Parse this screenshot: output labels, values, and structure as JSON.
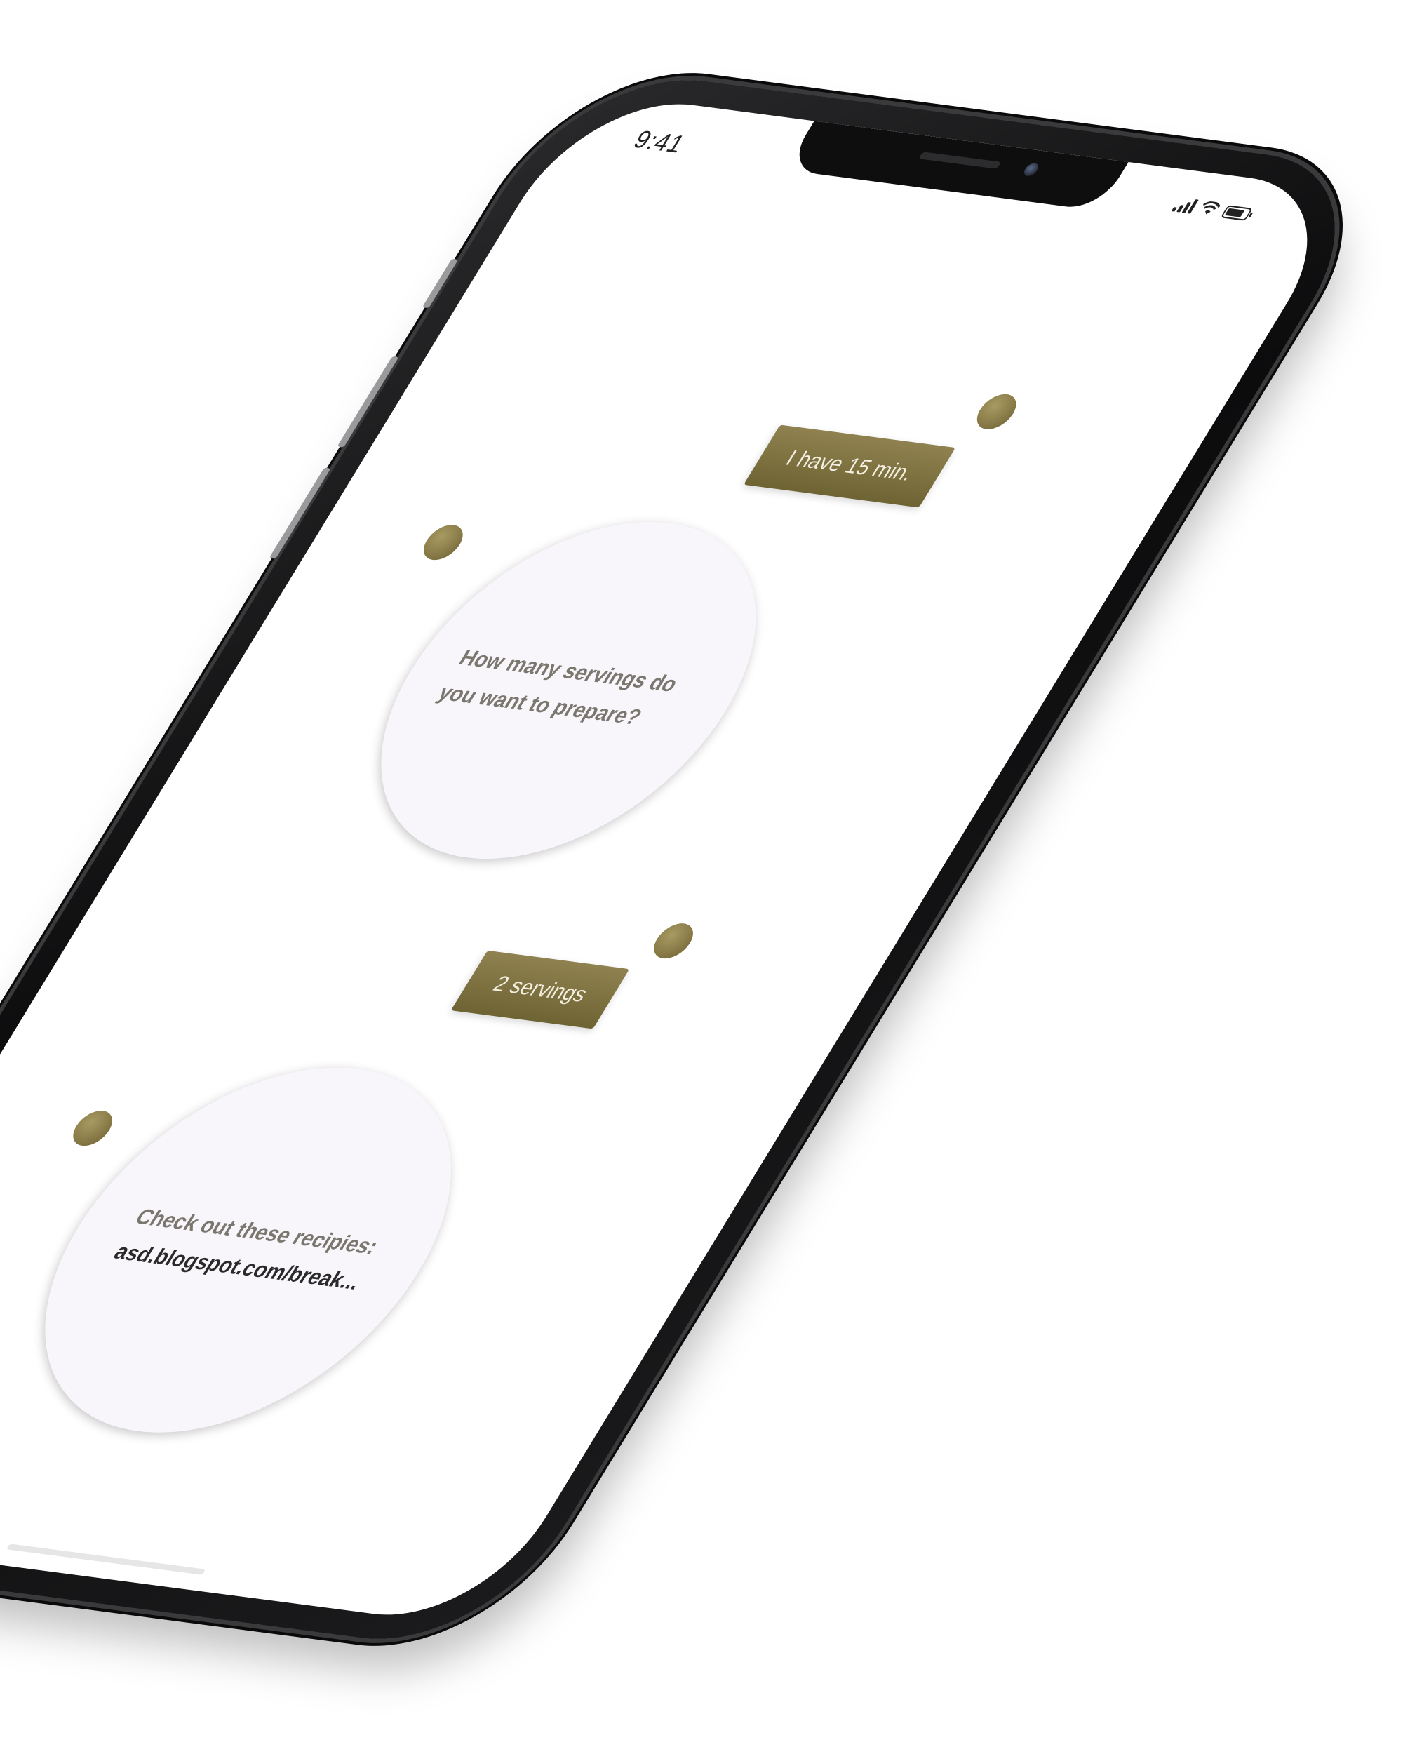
{
  "status_bar": {
    "time": "9:41",
    "icons": [
      "signal-icon",
      "wifi-icon",
      "battery-icon"
    ]
  },
  "chat": {
    "messages": [
      {
        "sender": "user",
        "text": "I have 15 min."
      },
      {
        "sender": "bot",
        "text": "How many servings do you want to prepare?"
      },
      {
        "sender": "user",
        "text": "2 servings"
      },
      {
        "sender": "bot",
        "text": "Check out these recipies:",
        "link": "asd.blogspot.com/break..."
      }
    ]
  },
  "colors": {
    "accent_gold": "#8f8250",
    "bubble_bg": "#f8f6fb",
    "phone_frame": "#0c0c0d"
  }
}
